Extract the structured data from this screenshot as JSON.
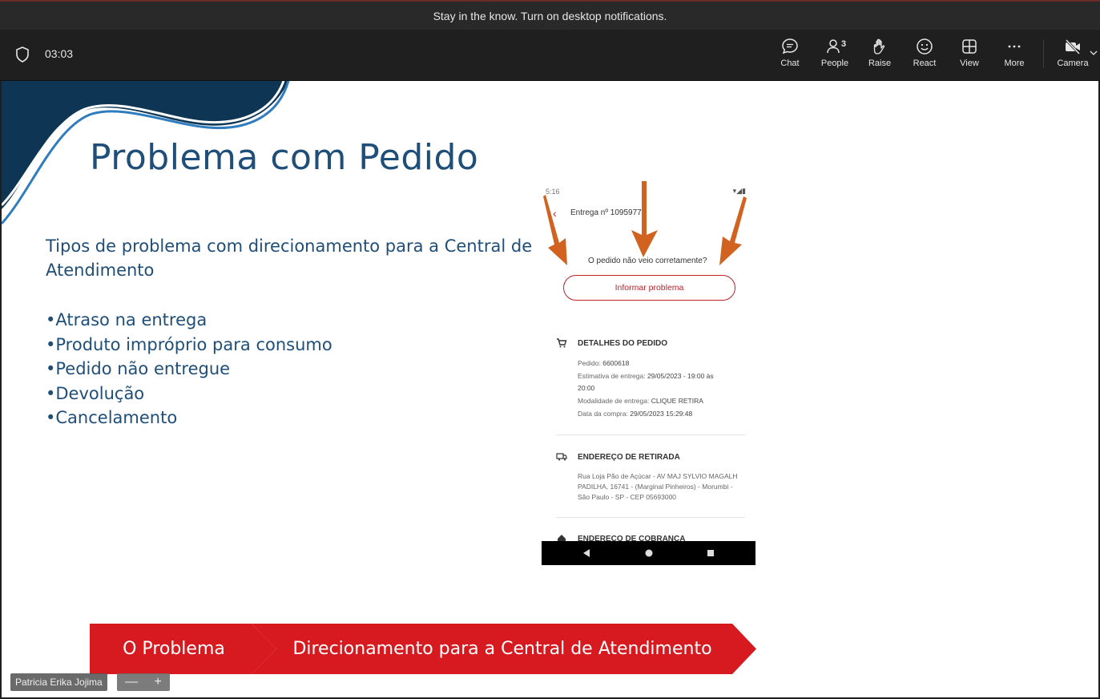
{
  "notification": {
    "text": "Stay in the know. Turn on desktop notifications."
  },
  "meeting": {
    "timer": "03:03"
  },
  "toolbar": {
    "chat_label": "Chat",
    "people_label": "People",
    "people_count": "3",
    "raise_label": "Raise",
    "react_label": "React",
    "view_label": "View",
    "more_label": "More",
    "camera_label": "Camera"
  },
  "slide": {
    "title": "Problema com Pedido",
    "intro": "Tipos de problema com direcionamento para a Central de Atendimento",
    "bullets": [
      "•Atraso na entrega",
      "•Produto impróprio para consumo",
      "•Pedido não entregue",
      "•Devolução",
      "•Cancelamento"
    ],
    "phone": {
      "time": "5:16",
      "header": "Entrega nº 1095977",
      "question": "O pedido não veio corretamente?",
      "report_button": "Informar problema",
      "details_title": "DETALHES DO PEDIDO",
      "order_label": "Pedido:",
      "order_value": "6600618",
      "estimate_label": "Estimativa de entrega:",
      "estimate_value": "29/05/2023 - 19:00 às",
      "estimate_value_2": "20:00",
      "mode_label": "Modalidade de entrega:",
      "mode_value": "CLIQUE RETIRA",
      "purchase_label": "Data da compra:",
      "purchase_value": "29/05/2023 15:29:48",
      "pickup_title": "ENDEREÇO DE RETIRADA",
      "pickup_line1": "Rua Loja Pão de Açúcar - AV MAJ SYLVIO MAGALH",
      "pickup_line2": "PADILHA, 16741 - (Marginal Pinheiros) - Morumbi -",
      "pickup_line3": "São Paulo - SP - CEP 05693000",
      "billing_title": "ENDERECO DE COBRANCA"
    },
    "chevron_1": "O Problema",
    "chevron_2": "Direcionamento para a Central de Atendimento"
  },
  "participant": {
    "name": "Patricia Erika Jojima"
  },
  "zoom": {
    "minus": "—",
    "plus": "+"
  },
  "colors": {
    "accent_red": "#d71920",
    "title_blue": "#1f4e79",
    "arrow_orange": "#d2621f"
  }
}
